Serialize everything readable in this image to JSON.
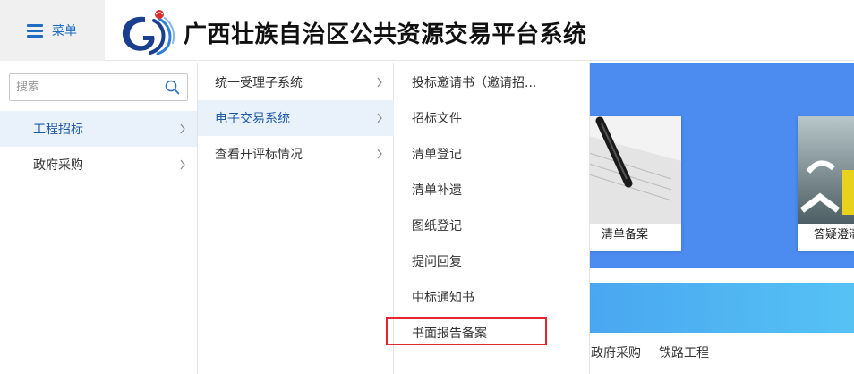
{
  "header": {
    "menu_label": "菜单",
    "title": "广西壮族自治区公共资源交易平台系统"
  },
  "sidebar": {
    "search_placeholder": "搜索",
    "items": [
      {
        "label": "工程招标"
      },
      {
        "label": "政府采购"
      }
    ]
  },
  "submenu": {
    "items": [
      {
        "label": "统一受理子系统"
      },
      {
        "label": "电子交易系统"
      },
      {
        "label": "查看开评标情况"
      }
    ]
  },
  "leafmenu": {
    "items": [
      {
        "label": "投标邀请书（邀请招..."
      },
      {
        "label": "招标文件"
      },
      {
        "label": "清单登记"
      },
      {
        "label": "清单补遗"
      },
      {
        "label": "图纸登记"
      },
      {
        "label": "提问回复"
      },
      {
        "label": "中标通知书"
      },
      {
        "label": "书面报告备案"
      }
    ]
  },
  "background": {
    "cards": [
      {
        "label": "清单备案"
      },
      {
        "label": "答疑澄清"
      }
    ],
    "tabs": [
      {
        "label": "政府采购"
      },
      {
        "label": "铁路工程"
      }
    ]
  },
  "colors": {
    "accent": "#1e6dc2",
    "active_bg": "#e9f1fb",
    "banner": "#4c8cf0",
    "highlight": "#e0282e"
  }
}
